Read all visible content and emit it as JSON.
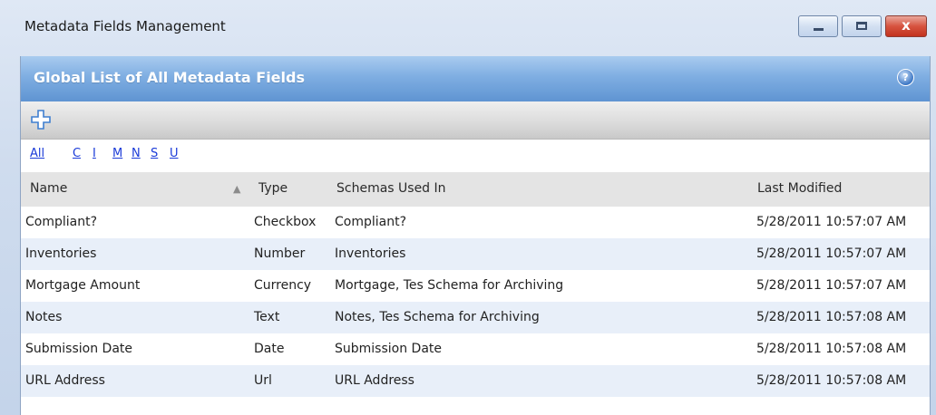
{
  "window": {
    "title": "Metadata Fields Management",
    "close_glyph": "x"
  },
  "panel": {
    "title": "Global List of All Metadata Fields",
    "help_glyph": "?"
  },
  "toolbar": {
    "add_icon": "plus-icon"
  },
  "alpha_filter": {
    "all": "All",
    "letters": [
      "C",
      "I",
      "M",
      "N",
      "S",
      "U"
    ]
  },
  "grid": {
    "columns": {
      "name": "Name",
      "type": "Type",
      "schemas": "Schemas Used In",
      "modified": "Last Modified"
    },
    "sort_indicator": "▲",
    "rows": [
      {
        "name": "Compliant?",
        "type": "Checkbox",
        "schemas": "Compliant?",
        "modified": "5/28/2011 10:57:07 AM"
      },
      {
        "name": "Inventories",
        "type": "Number",
        "schemas": "Inventories",
        "modified": "5/28/2011 10:57:07 AM"
      },
      {
        "name": "Mortgage Amount",
        "type": "Currency",
        "schemas": "Mortgage, Tes Schema for Archiving",
        "modified": "5/28/2011 10:57:07 AM"
      },
      {
        "name": "Notes",
        "type": "Text",
        "schemas": "Notes, Tes Schema for Archiving",
        "modified": "5/28/2011 10:57:08 AM"
      },
      {
        "name": "Submission Date",
        "type": "Date",
        "schemas": "Submission Date",
        "modified": "5/28/2011 10:57:08 AM"
      },
      {
        "name": "URL Address",
        "type": "Url",
        "schemas": "URL Address",
        "modified": "5/28/2011 10:57:08 AM"
      }
    ]
  },
  "colors": {
    "header_blue": "#6fa3de",
    "alt_row": "#e8eff9",
    "link_blue": "#1a3ad8"
  }
}
